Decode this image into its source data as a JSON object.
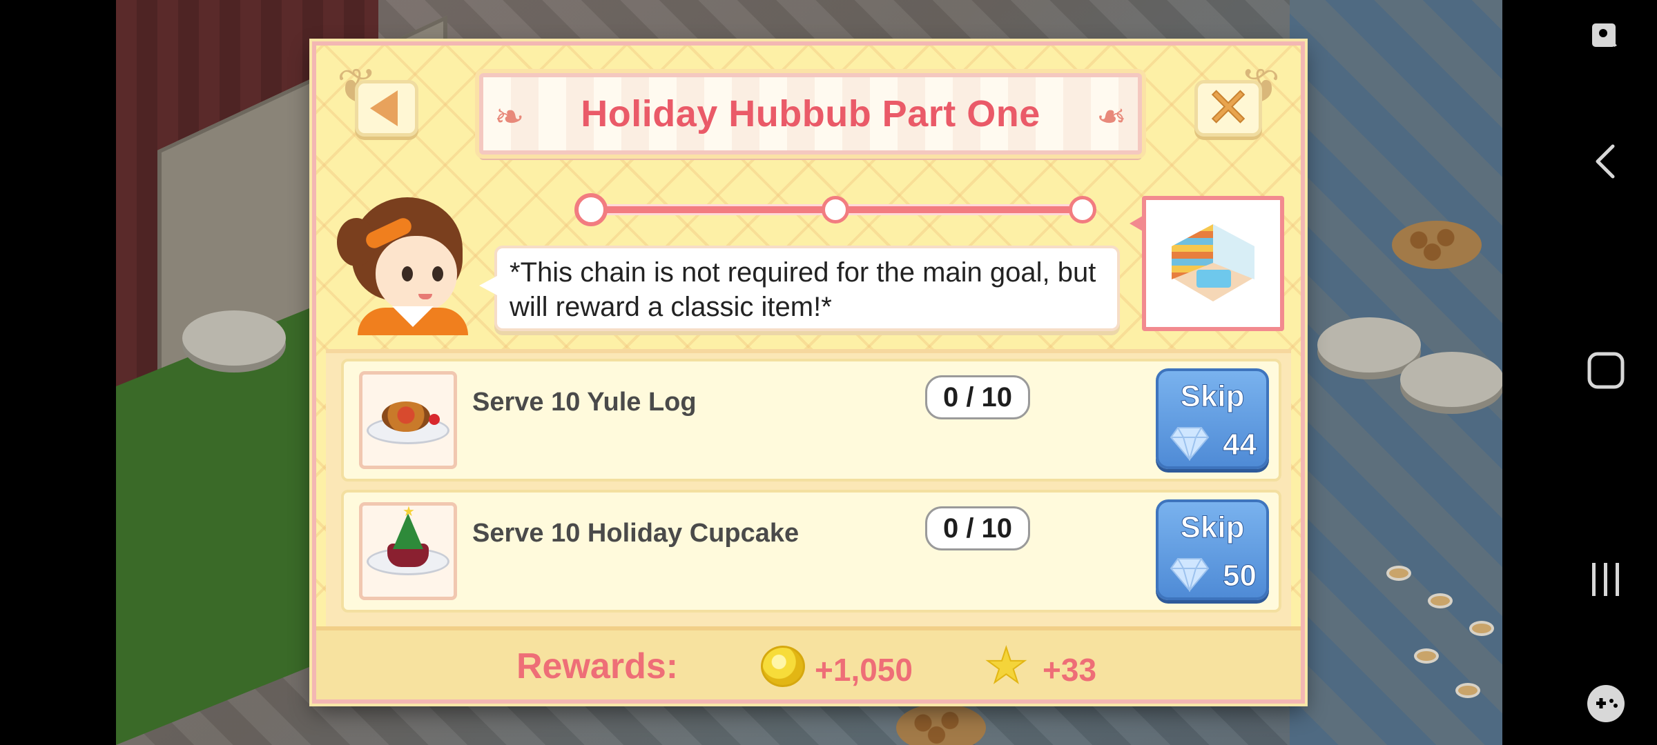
{
  "dialog": {
    "title": "Holiday Hubbub Part One",
    "message": "*This chain is not required for the main goal, but will reward a classic item!*",
    "chain_progress": {
      "current_step": 1,
      "total_steps": 3
    }
  },
  "tasks": [
    {
      "label": "Serve 10 Yule Log",
      "progress": "0 / 10",
      "skip_label": "Skip",
      "skip_cost": "44",
      "icon": "yule-log-icon"
    },
    {
      "label": "Serve 10 Holiday Cupcake",
      "progress": "0 / 10",
      "skip_label": "Skip",
      "skip_cost": "50",
      "icon": "holiday-cupcake-icon"
    }
  ],
  "rewards": {
    "label": "Rewards:",
    "coins": "+1,050",
    "stars": "+33"
  },
  "colors": {
    "title": "#ea5a68",
    "panel": "#fdf0a6",
    "skip_button": "#4f8bd6",
    "rewards_text": "#ee6e77"
  },
  "nav_icons": [
    "screen-lock-icon",
    "back-icon",
    "home-icon",
    "recents-icon",
    "game-tools-icon"
  ]
}
